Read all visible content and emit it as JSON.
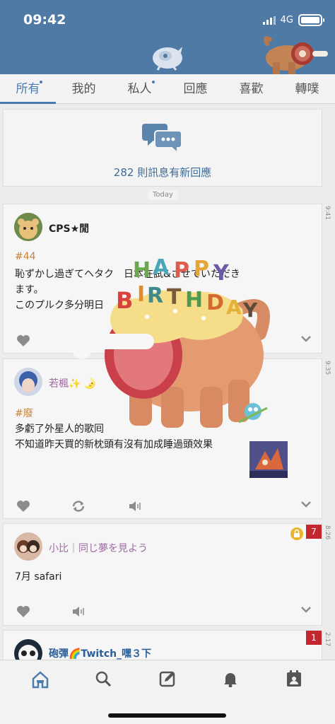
{
  "status_bar": {
    "time": "09:42",
    "network": "4G"
  },
  "tabs": [
    {
      "label": "所有",
      "active": true,
      "dot": true
    },
    {
      "label": "我的",
      "active": false,
      "dot": false
    },
    {
      "label": "私人",
      "active": false,
      "dot": true
    },
    {
      "label": "回應",
      "active": false,
      "dot": false
    },
    {
      "label": "喜歡",
      "active": false,
      "dot": false
    },
    {
      "label": "轉噗",
      "active": false,
      "dot": false
    }
  ],
  "notification": {
    "text": "282 則訊息有新回應",
    "icon": "chat-bubbles-icon"
  },
  "date_separator": "Today",
  "posts": [
    {
      "user": "CPS★閒",
      "time": "9:41",
      "tag": "#44",
      "lines": [
        "恥ずかし過ぎてヘタク　日本在試&させていただき",
        "ます。",
        "このプルク多分明日　"
      ]
    },
    {
      "user": "若楓✨ 🌛",
      "time": "9:35",
      "tag": "#廢",
      "lines": [
        "多虧了外星人的歌囘",
        "不知道昨天買的新枕頭有沒有加成睡過頭效果"
      ]
    },
    {
      "user": "小比｜同じ夢を見よう",
      "time": "8:26",
      "badge": "7",
      "lines": [
        "7月 safari"
      ]
    },
    {
      "user": "砲彈🌈Twitch_嘿３下",
      "time": "2:17",
      "badge": "1",
      "lines": []
    }
  ],
  "overlay_sticker": {
    "text": "HAPPY BIRTHDAY"
  },
  "colors": {
    "header": "#4f7aa6",
    "accent": "#4a7cb0",
    "badge": "#c4262e",
    "tag": "#c8833a"
  },
  "bottom_nav": [
    "home-icon",
    "search-icon",
    "compose-icon",
    "bell-icon",
    "calendar-user-icon"
  ]
}
